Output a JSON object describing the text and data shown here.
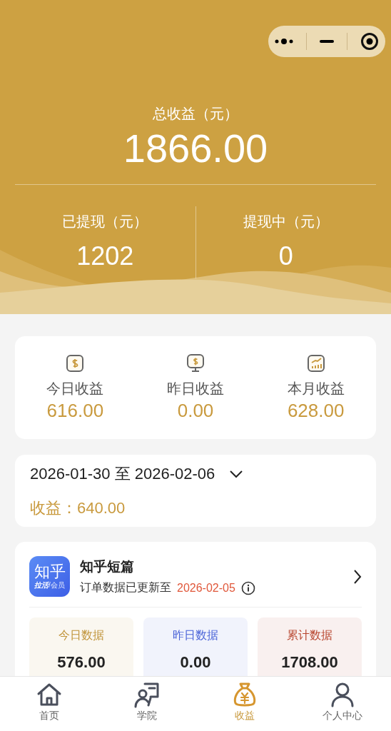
{
  "header": {
    "total_label": "总收益（元）",
    "total_value": "1866.00",
    "columns": [
      {
        "label": "已提现（元）",
        "value": "1202"
      },
      {
        "label": "提现中（元）",
        "value": "0"
      }
    ]
  },
  "stats": [
    {
      "kind": "coin",
      "label": "今日收益",
      "value": "616.00"
    },
    {
      "kind": "monitor",
      "label": "昨日收益",
      "value": "0.00"
    },
    {
      "kind": "chart",
      "label": "本月收益",
      "value": "628.00"
    }
  ],
  "date_range": {
    "start": "2026-01-30",
    "separator": "至",
    "end": "2026-02-06",
    "income": "收益：640.00"
  },
  "platform": {
    "logo_title": "知乎",
    "logo_sub1": "拉活",
    "logo_sub2": "/会员",
    "name": "知乎短篇",
    "update_text": "订单数据已更新至",
    "update_date": "2026-02-05",
    "tiles": [
      {
        "label": "今日数据",
        "value": "576.00",
        "color": "#c0943a"
      },
      {
        "label": "昨日数据",
        "value": "0.00",
        "color": "#4a63d8"
      },
      {
        "label": "累计数据",
        "value": "1708.00",
        "color": "#b8452e"
      }
    ]
  },
  "tabbar": [
    {
      "kind": "home",
      "label": "首页",
      "selected": false
    },
    {
      "kind": "academy",
      "label": "学院",
      "selected": false
    },
    {
      "kind": "money",
      "label": "收益",
      "selected": true
    },
    {
      "kind": "person",
      "label": "个人中心",
      "selected": false
    }
  ]
}
